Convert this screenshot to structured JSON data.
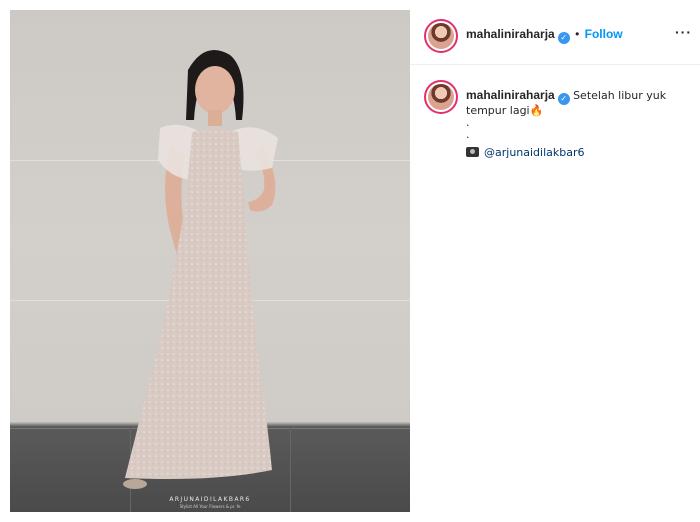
{
  "post": {
    "username": "mahaliniraharja",
    "follow_label": "Follow",
    "separator": "•",
    "more_label": "···",
    "watermark": "ARJUNAIDILAKBAR6",
    "watermark_sub": "Stylist All Your Flowers & pr. fe"
  },
  "caption": {
    "username": "mahaliniraharja",
    "text_line1": "Setelah libur yuk",
    "text_line2": "tempur lagi",
    "emoji": "🔥",
    "dot1": ".",
    "dot2": ".",
    "credit_mention": "@arjunaidilakbar6"
  },
  "colors": {
    "follow": "#0095f6",
    "verified": "#3897f0",
    "mention": "#00376b"
  }
}
